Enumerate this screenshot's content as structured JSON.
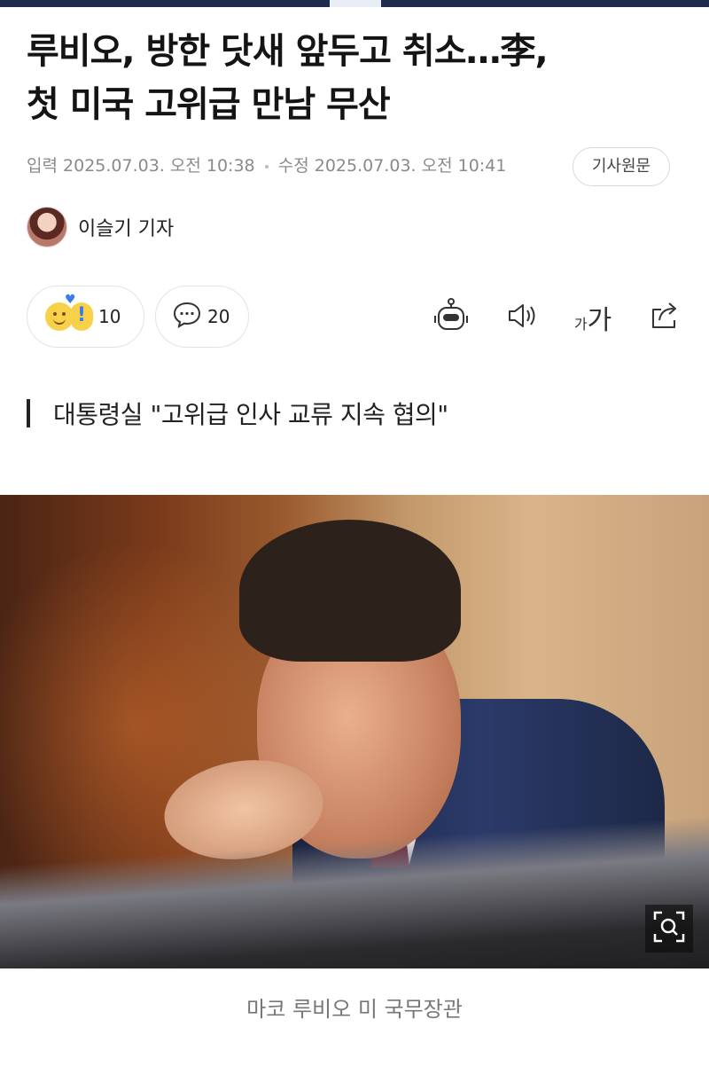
{
  "header": {
    "title_line1": "루비오, 방한 닷새 앞두고 취소…李,",
    "title_line2": "첫 미국 고위급 만남 무산"
  },
  "meta": {
    "input_label": "입력",
    "input_time": "2025.07.03. 오전 10:38",
    "edit_label": "수정",
    "edit_time": "2025.07.03. 오전 10:41",
    "original_button": "기사원문"
  },
  "author": {
    "name": "이슬기 기자"
  },
  "actions": {
    "reaction_count": "10",
    "comment_count": "20",
    "font_small": "가",
    "font_large": "가"
  },
  "article": {
    "subheading": "대통령실 \"고위급 인사 교류 지속 협의\"",
    "photo_caption": "마코 루비오 미 국무장관"
  },
  "colors": {
    "topbar": "#1d2c4c",
    "text": "#141414",
    "meta_gray": "#8a8a8a"
  },
  "icons": [
    "smile-emoji-icon",
    "surprised-emoji-icon",
    "comment-icon",
    "robot-icon",
    "speaker-icon",
    "font-size-icon",
    "share-icon",
    "zoom-icon"
  ]
}
